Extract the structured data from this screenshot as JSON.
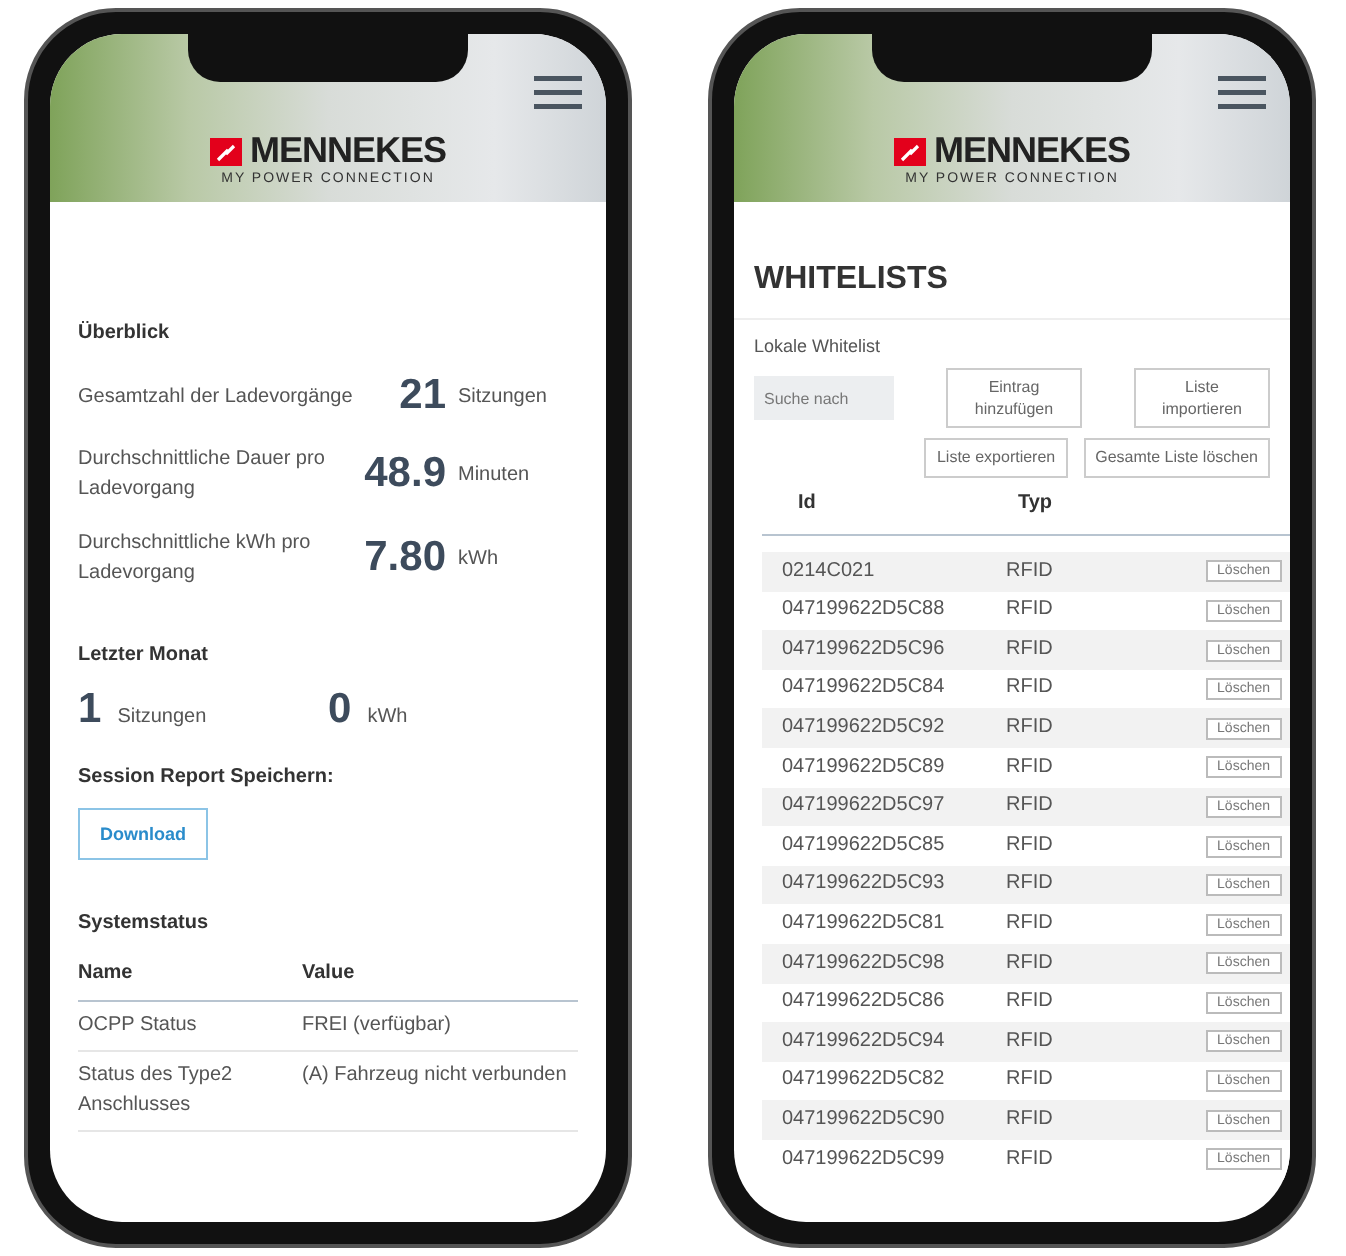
{
  "phones": [
    {
      "kind": "dashboard",
      "header": {
        "brand": "MENNEKES",
        "tagline": "MY POWER CONNECTION"
      },
      "overview": {
        "title": "Überblick",
        "stats": [
          {
            "label": "Gesamtzahl der Ladevorgänge",
            "value": "21",
            "unit": "Sitzungen"
          },
          {
            "label": "Durchschnittliche Dauer pro Ladevorgang",
            "value": "48.9",
            "unit": "Minuten"
          },
          {
            "label": "Durchschnittliche kWh pro Ladevorgang",
            "value": "7.80",
            "unit": "kWh"
          }
        ]
      },
      "last_month": {
        "title": "Letzter Monat",
        "stats": [
          {
            "value": "1",
            "unit": "Sitzungen"
          },
          {
            "value": "0",
            "unit": "kWh"
          }
        ]
      },
      "session_report": {
        "title": "Session Report Speichern:",
        "button": "Download"
      },
      "system_status": {
        "title": "Systemstatus",
        "columns": [
          "Name",
          "Value"
        ],
        "rows": [
          [
            "OCPP Status",
            "FREI (verfügbar)"
          ],
          [
            "Status des Type2 Anschlusses",
            "(A) Fahrzeug nicht verbunden"
          ]
        ]
      }
    },
    {
      "kind": "whitelist",
      "header": {
        "brand": "MENNEKES",
        "tagline": "MY POWER CONNECTION"
      },
      "title": "WHITELISTS",
      "subtitle": "Lokale Whitelist",
      "search": {
        "placeholder": "Suche nach"
      },
      "buttons": [
        "Eintrag hinzufügen",
        "Liste importieren",
        "Liste exportieren",
        "Gesamte Liste löschen"
      ],
      "table": {
        "columns": [
          "Id",
          "Typ"
        ],
        "rows": [
          {
            "id": "0214C021",
            "type": "RFID",
            "action": "Löschen"
          },
          {
            "id": "047199622D5C88",
            "type": "RFID",
            "action": "Löschen"
          },
          {
            "id": "047199622D5C96",
            "type": "RFID",
            "action": "Löschen"
          },
          {
            "id": "047199622D5C84",
            "type": "RFID",
            "action": "Löschen"
          },
          {
            "id": "047199622D5C92",
            "type": "RFID",
            "action": "Löschen"
          },
          {
            "id": "047199622D5C89",
            "type": "RFID",
            "action": "Löschen"
          },
          {
            "id": "047199622D5C97",
            "type": "RFID",
            "action": "Löschen"
          },
          {
            "id": "047199622D5C85",
            "type": "RFID",
            "action": "Löschen"
          },
          {
            "id": "047199622D5C93",
            "type": "RFID",
            "action": "Löschen"
          },
          {
            "id": "047199622D5C81",
            "type": "RFID",
            "action": "Löschen"
          },
          {
            "id": "047199622D5C98",
            "type": "RFID",
            "action": "Löschen"
          },
          {
            "id": "047199622D5C86",
            "type": "RFID",
            "action": "Löschen"
          },
          {
            "id": "047199622D5C94",
            "type": "RFID",
            "action": "Löschen"
          },
          {
            "id": "047199622D5C82",
            "type": "RFID",
            "action": "Löschen"
          },
          {
            "id": "047199622D5C90",
            "type": "RFID",
            "action": "Löschen"
          },
          {
            "id": "047199622D5C99",
            "type": "RFID",
            "action": "Löschen"
          }
        ]
      }
    }
  ]
}
